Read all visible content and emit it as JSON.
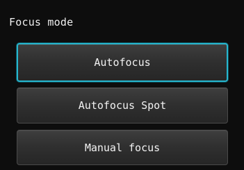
{
  "screen": {
    "title": "Focus mode",
    "options": [
      {
        "label": "Autofocus",
        "selected": true
      },
      {
        "label": "Autofocus Spot",
        "selected": false
      },
      {
        "label": "Manual focus",
        "selected": false
      }
    ]
  },
  "colors": {
    "background": "#0d0d0d",
    "button_fill": "#303030",
    "selected_border": "#27b7cf",
    "text": "#f2f2f2"
  }
}
